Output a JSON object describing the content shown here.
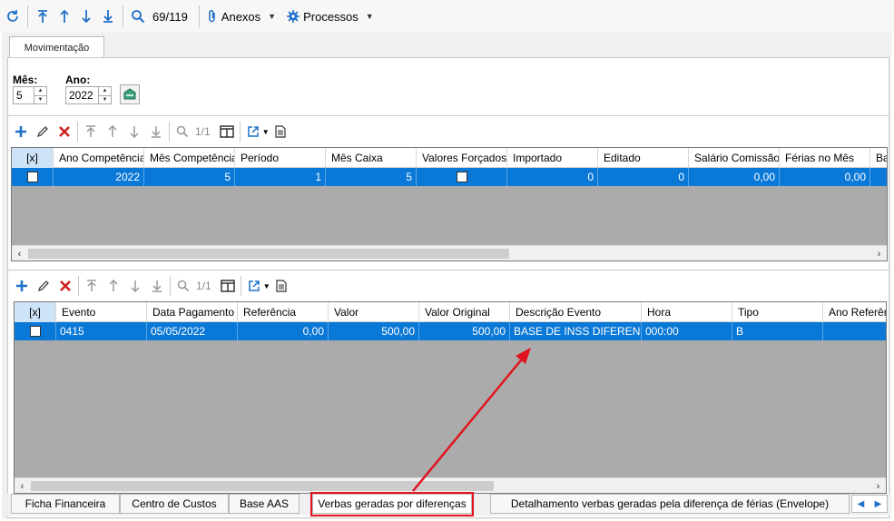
{
  "toolbar": {
    "record_counter": "69/119",
    "anexos_label": "Anexos",
    "processos_label": "Processos"
  },
  "tab_main": "Movimentação",
  "filters": {
    "mes_label": "Mês:",
    "mes_value": "5",
    "ano_label": "Ano:",
    "ano_value": "2022"
  },
  "grid1": {
    "counter": "1/1",
    "columns": [
      "[x]",
      "Ano Competência",
      "Mês Competência",
      "Período",
      "Mês Caixa",
      "Valores Forçados",
      "Importado",
      "Editado",
      "Salário Comissão",
      "Férias no Mês",
      "Ba"
    ],
    "row": [
      "",
      "2022",
      "5",
      "1",
      "5",
      "",
      "0",
      "0",
      "0,00",
      "0,00",
      ""
    ]
  },
  "grid2": {
    "counter": "1/1",
    "columns": [
      "[x]",
      "Evento",
      "Data Pagamento",
      "Referência",
      "Valor",
      "Valor Original",
      "Descrição Evento",
      "Hora",
      "Tipo",
      "Ano Referên"
    ],
    "row": [
      "",
      "0415",
      "05/05/2022",
      "0,00",
      "500,00",
      "500,00",
      "BASE DE INSS DIFEREN...",
      "000:00",
      "B",
      ""
    ]
  },
  "bottom_tabs": [
    "Ficha Financeira",
    "Centro de Custos",
    "Base AAS",
    "Verbas geradas por diferenças",
    "Detalhamento verbas geradas pela diferença de férias (Envelope)"
  ],
  "colors": {
    "selection": "#0a78d7",
    "highlight": "#e0141e",
    "grid_bg": "#ababab"
  }
}
